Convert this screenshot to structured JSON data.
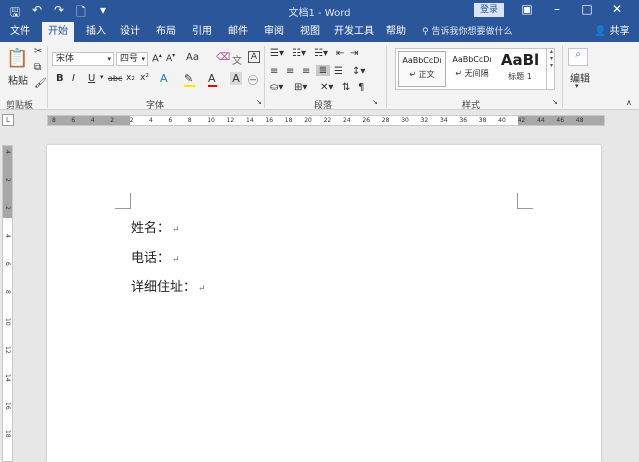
{
  "titlebar": {
    "title": "文档1 - Word",
    "login": "登录",
    "qat_icons": [
      "save-icon",
      "undo-icon",
      "redo-icon",
      "new-doc-icon",
      "customize-qat-icon"
    ]
  },
  "tabs": [
    "文件",
    "开始",
    "插入",
    "设计",
    "布局",
    "引用",
    "邮件",
    "审阅",
    "视图",
    "开发工具",
    "帮助"
  ],
  "active_tab": "开始",
  "tell_me": "告诉我你想要做什么",
  "share": "共享",
  "clipboard": {
    "paste": "粘贴",
    "label": "剪贴板"
  },
  "font": {
    "name": "宋体",
    "size": "四号",
    "grow": "A",
    "shrink": "A",
    "case": "Aa",
    "bold": "B",
    "italic": "I",
    "underline": "U",
    "strike": "abc",
    "subscript": "x₂",
    "superscript": "x²",
    "label": "字体"
  },
  "paragraph": {
    "label": "段落"
  },
  "styles": {
    "label": "样式",
    "items": [
      {
        "sample": "AaBbCcDı",
        "name": "正文"
      },
      {
        "sample": "AaBbCcDı",
        "name": "无间隔"
      },
      {
        "sample": "AaBl",
        "name": "标题 1"
      }
    ]
  },
  "editing": {
    "label": "编辑"
  },
  "ruler": {
    "h_ticks": [
      "8",
      "6",
      "4",
      "2",
      "2",
      "4",
      "6",
      "8",
      "10",
      "12",
      "14",
      "16",
      "18",
      "20",
      "22",
      "24",
      "26",
      "28",
      "30",
      "32",
      "34",
      "36",
      "38",
      "40",
      "42",
      "44",
      "46",
      "48"
    ],
    "v_ticks": [
      "4",
      "2",
      "2",
      "4",
      "6",
      "8",
      "10",
      "12",
      "14",
      "16",
      "18"
    ]
  },
  "document": {
    "lines": [
      "姓名：",
      "电话：",
      "详细住址："
    ]
  },
  "colors": {
    "accent": "#2b579a",
    "ribbon": "#f3f3f3",
    "canvas": "#e7e7e7"
  }
}
